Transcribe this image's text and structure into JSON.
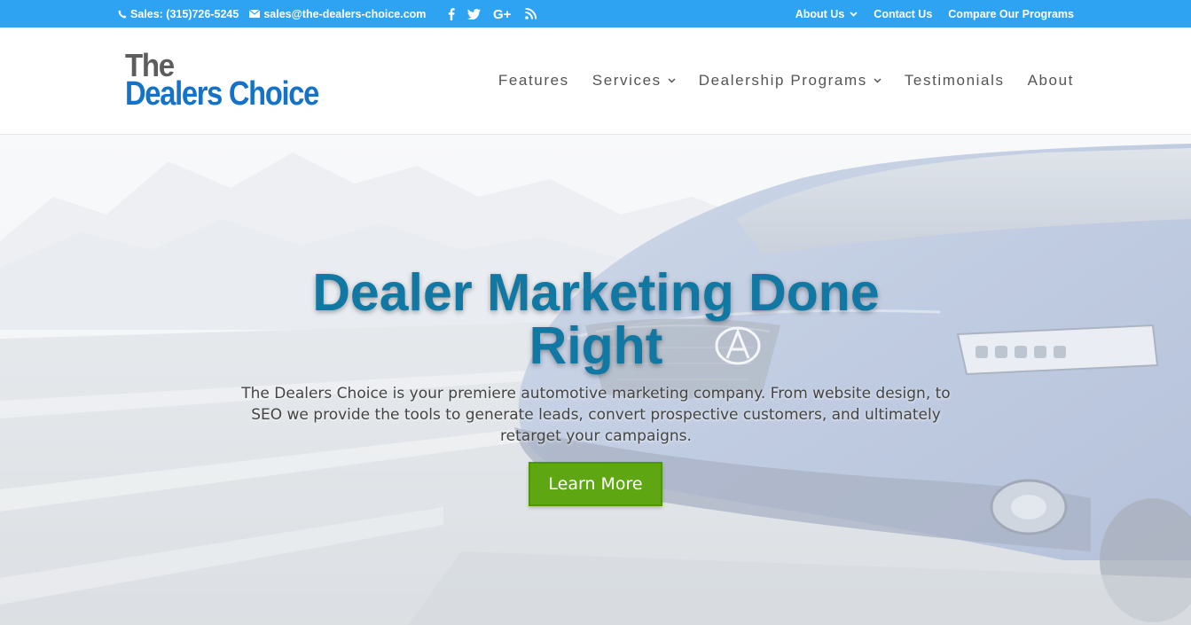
{
  "topbar": {
    "phone": "Sales: (315)726-5245",
    "email": "sales@the-dealers-choice.com",
    "social": [
      "facebook-icon",
      "twitter-icon",
      "google-plus-icon",
      "rss-icon"
    ],
    "links": [
      {
        "label": "About Us",
        "has_dropdown": true
      },
      {
        "label": "Contact Us",
        "has_dropdown": false
      },
      {
        "label": "Compare Our Programs",
        "has_dropdown": false
      }
    ],
    "bg_color": "#2ea3f2"
  },
  "logo": {
    "line1": "The",
    "line2": "Dealers Choice",
    "color1": "#5d5d5d",
    "color2": "#1473c9"
  },
  "nav": [
    {
      "label": "Features",
      "has_dropdown": false
    },
    {
      "label": "Services",
      "has_dropdown": true
    },
    {
      "label": "Dealership Programs",
      "has_dropdown": true
    },
    {
      "label": "Testimonials",
      "has_dropdown": false
    },
    {
      "label": "About",
      "has_dropdown": false
    }
  ],
  "hero": {
    "title": "Dealer Marketing Done Right",
    "text": "The Dealers Choice is your premiere automotive marketing company. From website design, to SEO we provide the tools to generate leads, convert prospective customers, and ultimately retarget your campaigns.",
    "button": "Learn More",
    "title_color": "#1078a3",
    "button_color": "#5fa712"
  }
}
